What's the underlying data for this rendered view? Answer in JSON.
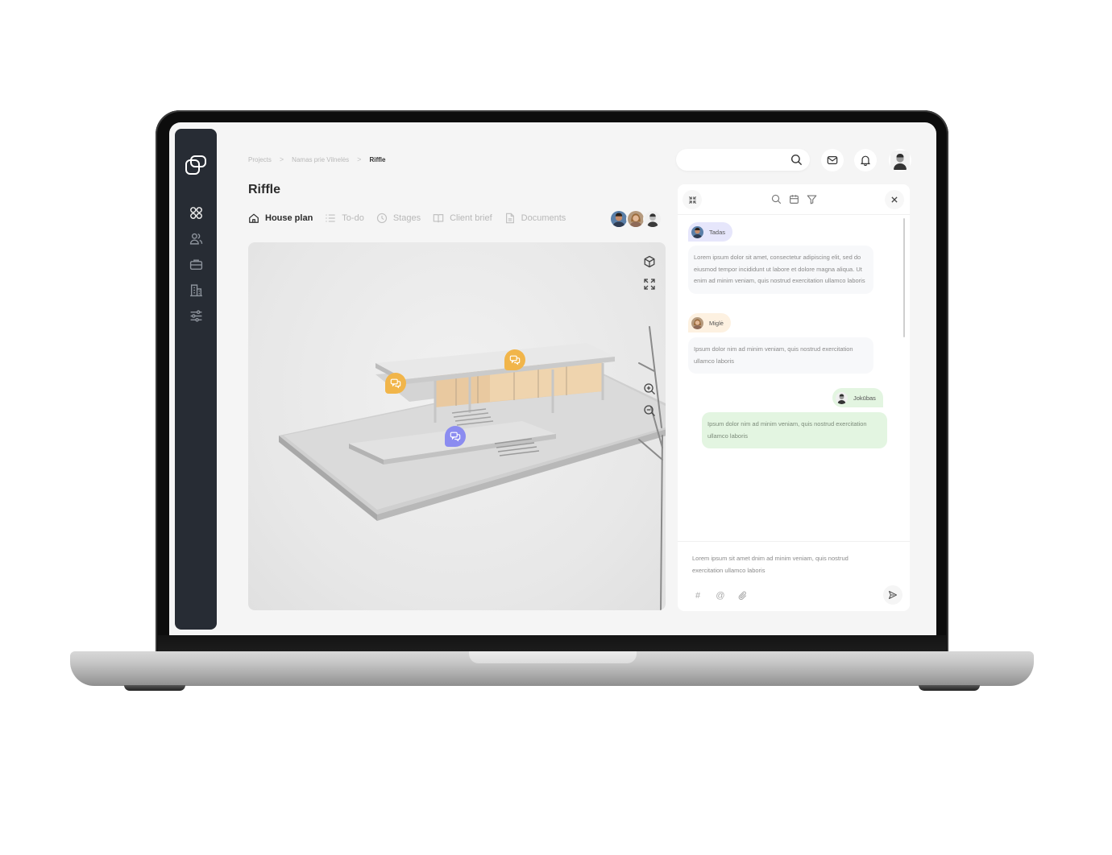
{
  "breadcrumb": {
    "items": [
      "Projects",
      "Namas prie Vilnelės"
    ],
    "current": "Riffle",
    "separator": ">"
  },
  "page": {
    "title": "Riffle"
  },
  "tabs": [
    {
      "label": "House plan",
      "icon": "home-icon",
      "active": true
    },
    {
      "label": "To-do",
      "icon": "list-icon",
      "active": false
    },
    {
      "label": "Stages",
      "icon": "clock-icon",
      "active": false
    },
    {
      "label": "Client brief",
      "icon": "book-icon",
      "active": false
    },
    {
      "label": "Documents",
      "icon": "document-icon",
      "active": false
    }
  ],
  "team_avatars": [
    "member-1",
    "member-2",
    "member-3"
  ],
  "sidebar": {
    "items": [
      {
        "name": "dashboard",
        "icon": "grid-icon"
      },
      {
        "name": "users",
        "icon": "users-icon"
      },
      {
        "name": "projects",
        "icon": "briefcase-icon"
      },
      {
        "name": "buildings",
        "icon": "building-icon"
      },
      {
        "name": "settings",
        "icon": "sliders-icon"
      }
    ]
  },
  "topbar": {
    "search_placeholder": "",
    "icons": [
      "search-icon",
      "mail-icon",
      "bell-icon",
      "user-avatar"
    ]
  },
  "viewer": {
    "tools": [
      "cube-icon",
      "fullscreen-icon",
      "zoom-in-icon",
      "zoom-out-icon"
    ],
    "markers": [
      {
        "color": "orange"
      },
      {
        "color": "orange"
      },
      {
        "color": "purple"
      }
    ]
  },
  "chat": {
    "header_icons": [
      "collapse-icon",
      "search-icon",
      "calendar-icon",
      "filter-icon",
      "close-icon"
    ],
    "messages": [
      {
        "author": "Tadas",
        "side": "left",
        "text": "Lorem ipsum dolor sit amet, consectetur adipiscing elit, sed do eiusmod tempor incididunt ut labore et dolore magna aliqua. Ut enim ad minim veniam, quis nostrud exercitation ullamco laboris"
      },
      {
        "author": "Miglė",
        "side": "left",
        "text": "Ipsum dolor nim ad minim veniam, quis nostrud exercitation ullamco laboris"
      },
      {
        "author": "Jokūbas",
        "side": "right",
        "text": "Ipsum dolor nim ad minim veniam, quis nostrud exercitation ullamco laboris"
      }
    ],
    "input_text": "Lorem ipsum sit amet dnim ad minim veniam, quis nostrud exercitation ullamco laboris",
    "input_tools": [
      "#",
      "@",
      "attachment"
    ]
  },
  "colors": {
    "sidebar_bg": "#272c34",
    "marker_orange": "#f1b54a",
    "marker_purple": "#8b8cf0",
    "chip_tadas": "#e6e6fb",
    "chip_migle": "#fdf1e1",
    "chip_jokubas": "#e3f5e1",
    "bubble_own": "#e3f5e1",
    "bubble_other": "#f7f8fa"
  }
}
